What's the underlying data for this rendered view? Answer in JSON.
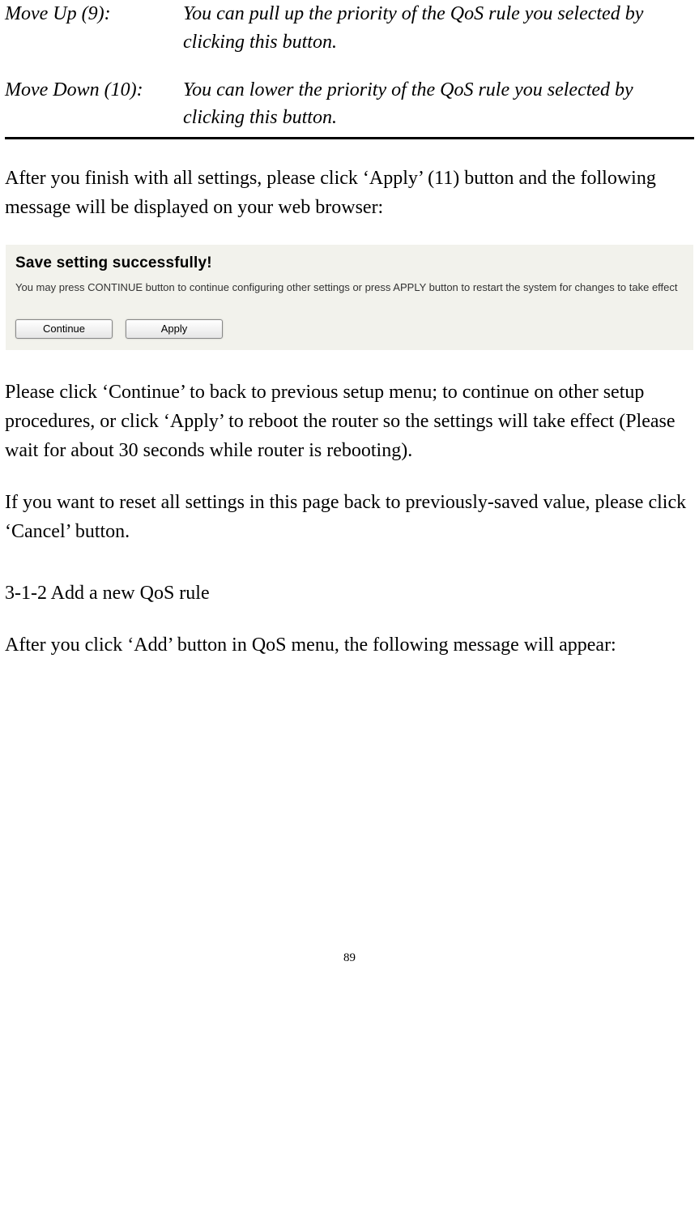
{
  "definitions": [
    {
      "term": "Move Up (9):",
      "desc": "You can pull up the priority of the QoS rule you selected by clicking this button."
    },
    {
      "term": "Move Down (10):",
      "desc": "You can lower the priority of the QoS rule you selected by clicking this button."
    }
  ],
  "para_after_defs": "After you finish with all settings, please click ‘Apply’ (11) button and the following message will be displayed on your web browser:",
  "screenshot": {
    "title": "Save setting successfully!",
    "message": "You may press CONTINUE button to continue configuring other settings or press APPLY button to restart the system for changes to take effect",
    "continue_label": "Continue",
    "apply_label": "Apply"
  },
  "para_after_shot_1": "Please click ‘Continue’ to back to previous setup menu; to continue on other setup procedures, or click ‘Apply’ to reboot the router so the settings will take effect (Please wait for about 30 seconds while router is rebooting).",
  "para_after_shot_2": "If you want to reset all settings in this page back to previously-saved value, please click ‘Cancel’ button.",
  "section_heading": "3-1-2 Add a new QoS rule",
  "para_section": "After you click ‘Add’ button in QoS menu, the following message will appear:",
  "page_number": "89"
}
